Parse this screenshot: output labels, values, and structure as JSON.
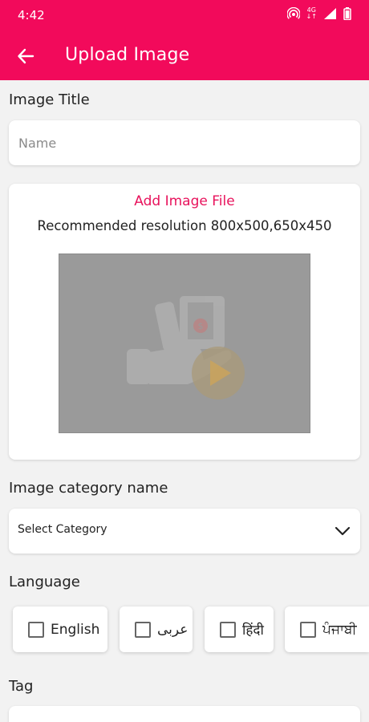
{
  "status_bar": {
    "time": "4:42",
    "network": "4G"
  },
  "header": {
    "title": "Upload Image"
  },
  "image_title": {
    "label": "Image Title",
    "placeholder": "Name"
  },
  "upload": {
    "add_file": "Add Image File",
    "recommended": "Recommended resolution 800x500,650x450"
  },
  "category": {
    "label": "Image category name",
    "selected": "Select Category"
  },
  "language": {
    "label": "Language",
    "options": [
      {
        "label": "English",
        "checked": false
      },
      {
        "label": "عربى",
        "checked": false
      },
      {
        "label": "हिंदी",
        "checked": false
      },
      {
        "label": "ਪੰਜਾਬੀ",
        "checked": false
      }
    ]
  },
  "tag": {
    "label": "Tag"
  },
  "colors": {
    "accent": "#f20a5b",
    "background": "#f2f2f2"
  }
}
